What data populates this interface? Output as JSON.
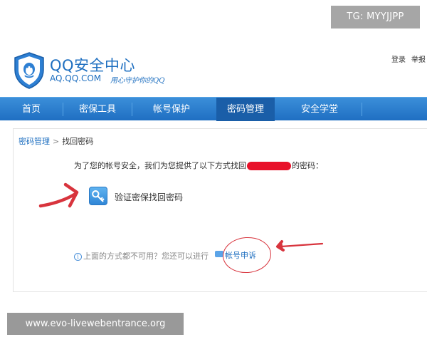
{
  "header": {
    "brand_title": "QQ安全中心",
    "brand_url": "AQ.QQ.COM",
    "slogan": "用心守护你的QQ",
    "login": "登录",
    "report": "举报"
  },
  "nav": {
    "items": [
      {
        "label": "首页"
      },
      {
        "label": "密保工具"
      },
      {
        "label": "帐号保护"
      },
      {
        "label": "密码管理",
        "active": true
      },
      {
        "label": "安全学堂"
      }
    ]
  },
  "breadcrumb": {
    "parent": "密码管理",
    "separator": ">",
    "current": "找回密码"
  },
  "main": {
    "intro_before": "为了您的帐号安全，我们为您提供了以下方式找回",
    "intro_after": "的密码：",
    "verify_option": "验证密保找回密码",
    "fallback_text": "上面的方式都不可用？您还可以进行",
    "appeal_link": "帐号申诉"
  },
  "watermarks": {
    "top": "TG: MYYJJPP",
    "bottom": "www.evo-livewebentrance.org"
  },
  "colors": {
    "brand_blue": "#1e6fc0",
    "nav_blue": "#2a7fcf",
    "annotation_red": "#d8343d"
  },
  "icons": {
    "logo": "shield-penguin-icon",
    "verify": "key-icon",
    "info": "info-icon",
    "appeal": "chat-bubble-icon"
  }
}
